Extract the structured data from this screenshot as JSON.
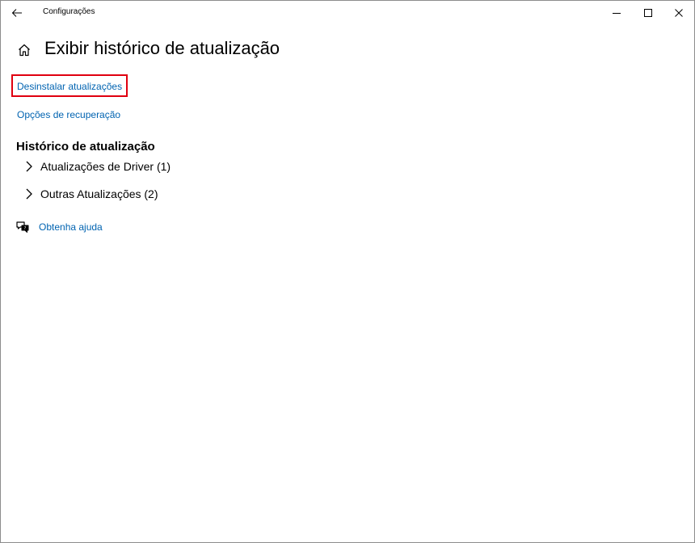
{
  "window": {
    "title": "Configurações",
    "icons": {
      "back": "arrow-left-icon",
      "minimize": "minimize-icon",
      "maximize": "maximize-icon",
      "close": "close-icon"
    }
  },
  "header": {
    "home_icon": "home-icon",
    "title": "Exibir histórico de atualização"
  },
  "links": {
    "uninstall": "Desinstalar atualizações",
    "recovery": "Opções de recuperação"
  },
  "history": {
    "heading": "Histórico de atualização",
    "groups": [
      {
        "label": "Atualizações de Driver (1)",
        "icon": "chevron-right-icon"
      },
      {
        "label": "Outras Atualizações (2)",
        "icon": "chevron-right-icon"
      }
    ]
  },
  "help": {
    "icon": "help-chat-icon",
    "label": "Obtenha ajuda"
  },
  "colors": {
    "link": "#0063b1",
    "highlight": "#e0000f",
    "border": "#8c8c8c"
  }
}
